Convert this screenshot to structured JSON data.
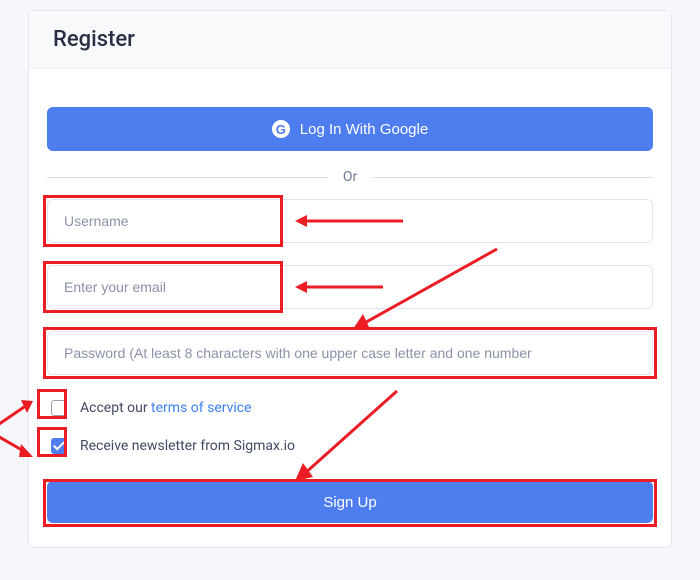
{
  "header": {
    "title": "Register"
  },
  "google": {
    "label": "Log In With Google",
    "glyph": "G"
  },
  "divider": {
    "text": "Or"
  },
  "fields": {
    "username": {
      "placeholder": "Username",
      "value": ""
    },
    "email": {
      "placeholder": "Enter your email",
      "value": ""
    },
    "password": {
      "placeholder": "Password (At least 8 characters with one upper case letter and one number",
      "value": ""
    }
  },
  "terms": {
    "prefix": "Accept our ",
    "link_text": "terms of service",
    "checked": false
  },
  "newsletter": {
    "label": "Receive newsletter from Sigmax.io",
    "checked": true
  },
  "signup": {
    "label": "Sign Up"
  },
  "annotation_color": "#eb1c24"
}
